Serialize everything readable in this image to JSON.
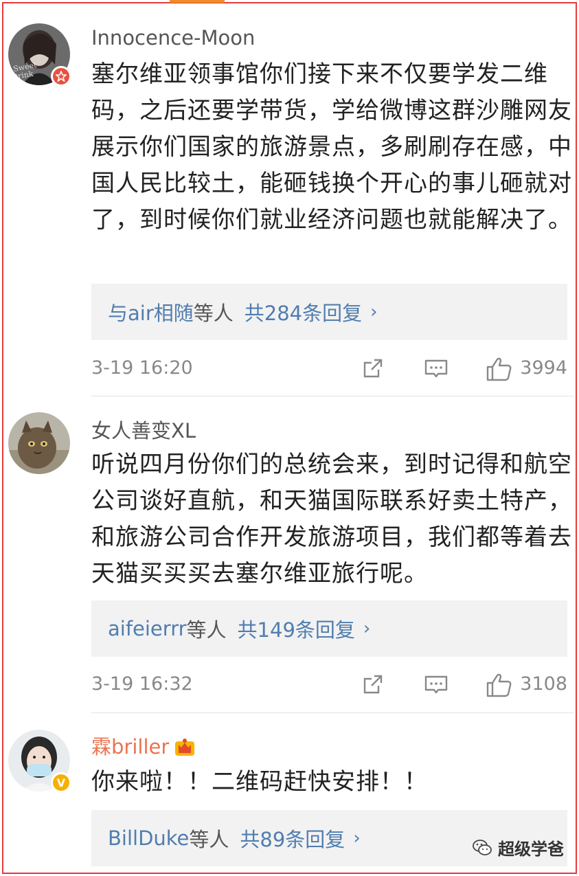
{
  "comments": [
    {
      "username": "Innocence-Moon",
      "text": "塞尔维亚领事馆你们接下来不仅要学发二维码，之后还要学带货，学给微博这群沙雕网友展示你们国家的旅游景点，多刷刷存在感，中国人民比较土，能砸钱换个开心的事儿砸就对了，到时候你们就业经济问题也就能解决了。",
      "replies": {
        "users": "与air相随",
        "suffix": "等人",
        "count": "共284条回复",
        "chevron": "›"
      },
      "time": "3-19 16:20",
      "likes": "3994",
      "badge_icon": "red-star-badge-icon"
    },
    {
      "username": "女人善变XL",
      "text": "听说四月份你们的总统会来，到时记得和航空公司谈好直航，和天猫国际联系好卖土特产，和旅游公司合作开发旅游项目，我们都等着去天猫买买买去塞尔维亚旅行呢。",
      "replies": {
        "users": "aifeierrr",
        "suffix": "等人",
        "count": "共149条回复",
        "chevron": "›"
      },
      "time": "3-19 16:32",
      "likes": "3108"
    },
    {
      "username": "霖briller",
      "text": "你来啦！！二维码赶快安排！！",
      "replies": {
        "users": "BillDuke",
        "suffix": "等人",
        "count": "共89条回复",
        "chevron": "›"
      },
      "badge_icon": "yellow-verified-v-icon",
      "badge_label": "V"
    }
  ],
  "watermark": "超级学爸",
  "colors": {
    "border": "#e5393b",
    "link": "#507daf",
    "vip_name": "#eb7350",
    "top_indicator": "#f08b2c"
  }
}
